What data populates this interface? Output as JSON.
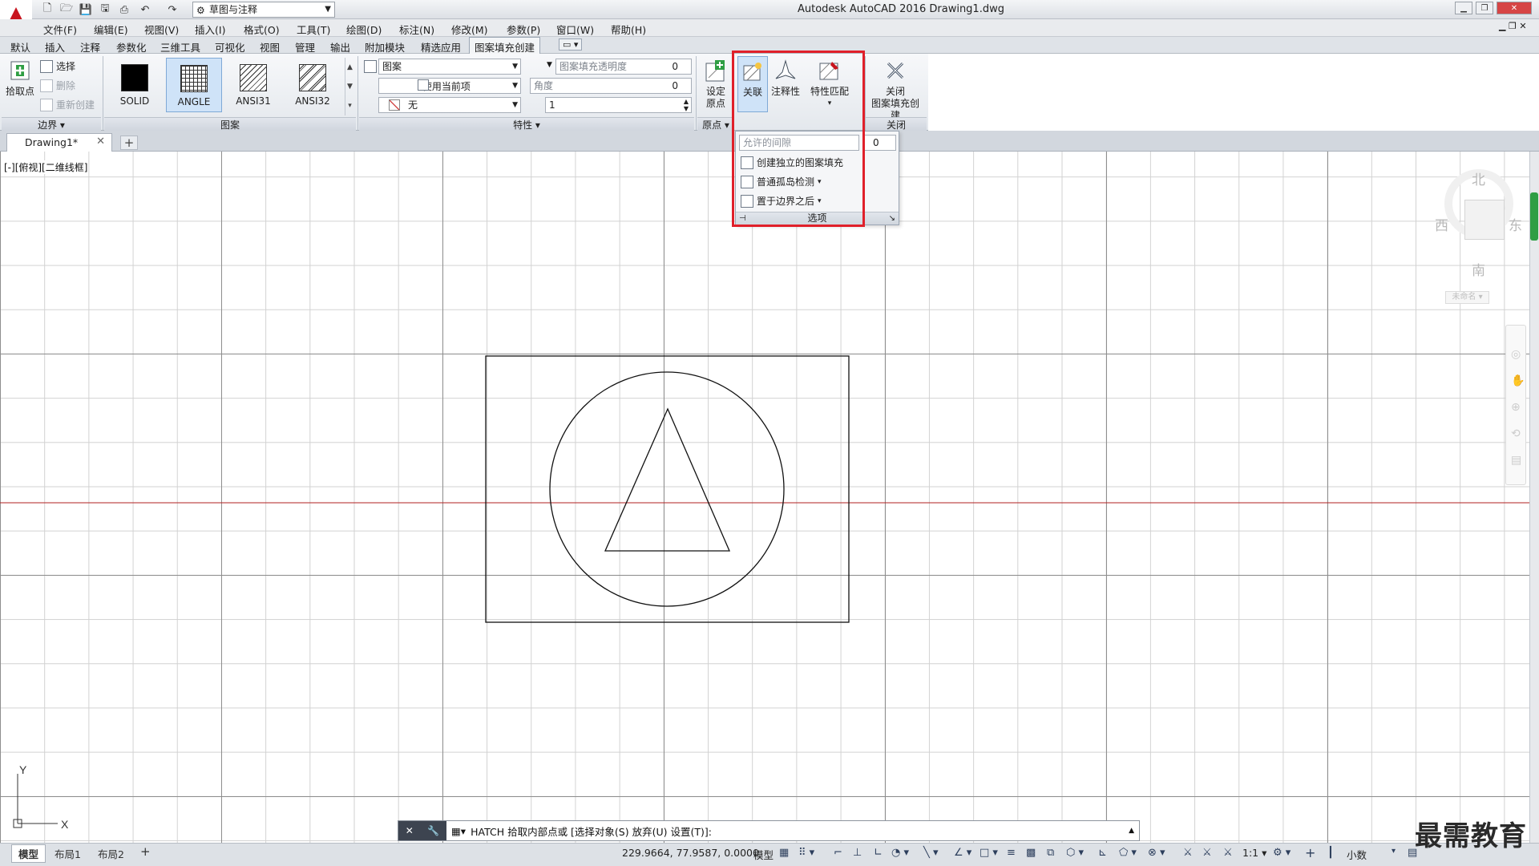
{
  "titlebar": {
    "workspace": "草图与注释",
    "title": "Autodesk AutoCAD 2016    Drawing1.dwg"
  },
  "menu": [
    "文件(F)",
    "编辑(E)",
    "视图(V)",
    "插入(I)",
    "格式(O)",
    "工具(T)",
    "绘图(D)",
    "标注(N)",
    "修改(M)",
    "参数(P)",
    "窗口(W)",
    "帮助(H)"
  ],
  "ribbon_tabs": [
    "默认",
    "插入",
    "注释",
    "参数化",
    "三维工具",
    "可视化",
    "视图",
    "管理",
    "输出",
    "附加模块",
    "精选应用",
    "图案填充创建"
  ],
  "ribbon": {
    "boundary": {
      "pick_point": "拾取点",
      "select": "选择",
      "remove": "删除",
      "recreate": "重新创建",
      "title": "边界"
    },
    "pattern": {
      "tiles": [
        "SOLID",
        "ANGLE",
        "ANSI31",
        "ANSI32"
      ],
      "title": "图案"
    },
    "properties": {
      "type": "图案",
      "color": "使用当前项",
      "background": "无",
      "transparency_label": "图案填充透明度",
      "transparency_value": "0",
      "angle_label": "角度",
      "angle_value": "0",
      "scale_value": "1",
      "title": "特性"
    },
    "origin": {
      "set_origin_l1": "设定",
      "set_origin_l2": "原点",
      "title": "原点"
    },
    "options": {
      "associative": "关联",
      "annotative": "注释性",
      "match_l1": "特性匹配",
      "gap_label": "允许的间隙",
      "gap_value": "0",
      "create_separate": "创建独立的图案填充",
      "island": "普通孤岛检测",
      "draw_order": "置于边界之后",
      "title": "选项"
    },
    "close": {
      "label_l1": "关闭",
      "label_l2": "图案填充创建",
      "title": "关闭"
    }
  },
  "document": {
    "tab": "Drawing1*",
    "view_label": "[-][俯视][二维线框]"
  },
  "viewcube": {
    "north": "北",
    "south": "南",
    "east": "东",
    "west": "西",
    "wcs": "未命名"
  },
  "command": {
    "prompt": "HATCH 拾取内部点或 [选择对象(S) 放弃(U) 设置(T)]:"
  },
  "status": {
    "tabs": [
      "模型",
      "布局1",
      "布局2"
    ],
    "coords": "229.9664, 77.9587, 0.0000",
    "model": "模型",
    "scale": "1:1",
    "units": "小数"
  },
  "watermark": "最需教育",
  "colors": {
    "accent": "#c8141e",
    "highlight": "#e0202a",
    "axis_red": "#b22222"
  }
}
